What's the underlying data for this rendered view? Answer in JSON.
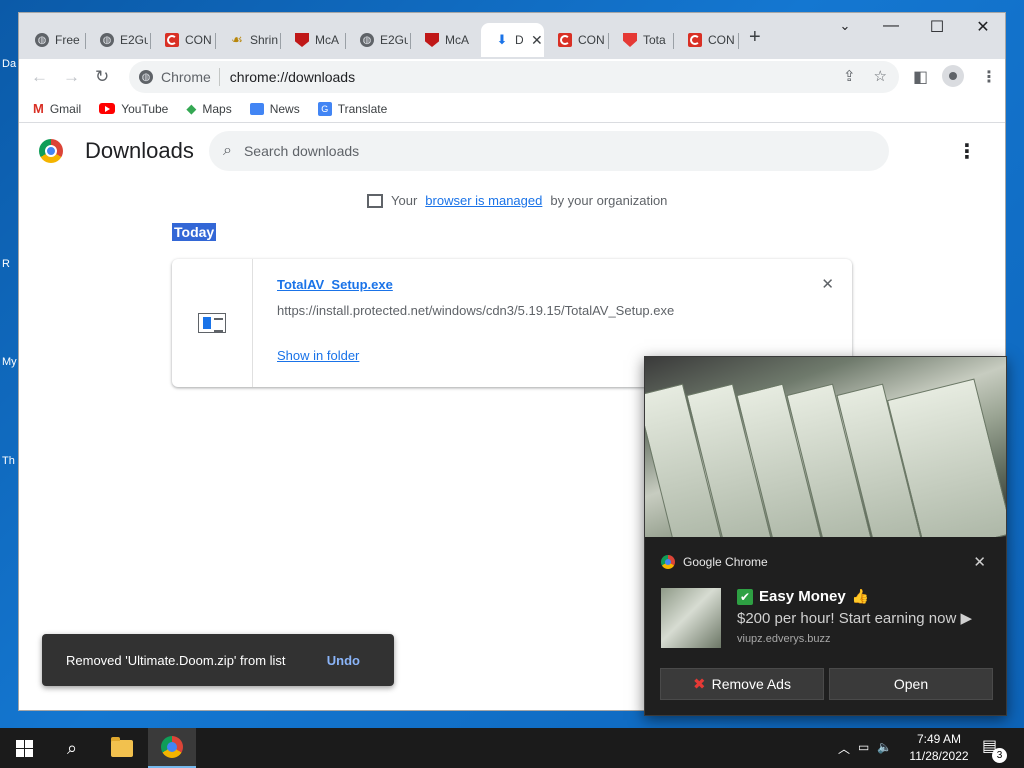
{
  "desktop": {
    "icons": [
      "Da",
      "R",
      "My",
      "Th"
    ]
  },
  "tabs": [
    {
      "title": "Free",
      "favicon": "globe-icon"
    },
    {
      "title": "E2Gu",
      "favicon": "globe-icon"
    },
    {
      "title": "CON",
      "favicon": "red-phone-icon"
    },
    {
      "title": "Shrin",
      "favicon": "shrimp-icon"
    },
    {
      "title": "McA",
      "favicon": "mcafee-icon"
    },
    {
      "title": "E2Gu",
      "favicon": "globe-icon"
    },
    {
      "title": "McA",
      "favicon": "mcafee-icon"
    },
    {
      "title": "D",
      "favicon": "download-icon",
      "active": true
    },
    {
      "title": "CON",
      "favicon": "red-phone-icon"
    },
    {
      "title": "Tota",
      "favicon": "totalav-icon"
    },
    {
      "title": "CON",
      "favicon": "red-phone-icon"
    }
  ],
  "omnibox": {
    "chip": "Chrome",
    "url": "chrome://downloads"
  },
  "bookmarks": [
    {
      "label": "Gmail",
      "icon": "gmail-icon"
    },
    {
      "label": "YouTube",
      "icon": "youtube-icon"
    },
    {
      "label": "Maps",
      "icon": "maps-icon"
    },
    {
      "label": "News",
      "icon": "news-icon"
    },
    {
      "label": "Translate",
      "icon": "translate-icon"
    }
  ],
  "downloads": {
    "title": "Downloads",
    "search_placeholder": "Search downloads",
    "managed": {
      "prefix": "Your",
      "link": "browser is managed",
      "suffix": "by your organization"
    },
    "section": "Today",
    "item": {
      "filename": "TotalAV_Setup.exe",
      "url": "https://install.protected.net/windows/cdn3/5.19.15/TotalAV_Setup.exe",
      "show_in_folder": "Show in folder"
    }
  },
  "toast": {
    "message": "Removed 'Ultimate.Doom.zip' from list",
    "undo": "Undo"
  },
  "notification": {
    "app": "Google Chrome",
    "title": "Easy Money",
    "body": "$200 per hour! Start earning now ▶",
    "domain": "viupz.edverys.buzz",
    "remove_ads": "Remove Ads",
    "open": "Open"
  },
  "taskbar": {
    "time": "7:49 AM",
    "date": "11/28/2022",
    "notification_count": "3"
  },
  "colors": {
    "accent": "#1a73e8",
    "selection": "#3367d6",
    "taskbar": "#1b1b1b"
  }
}
